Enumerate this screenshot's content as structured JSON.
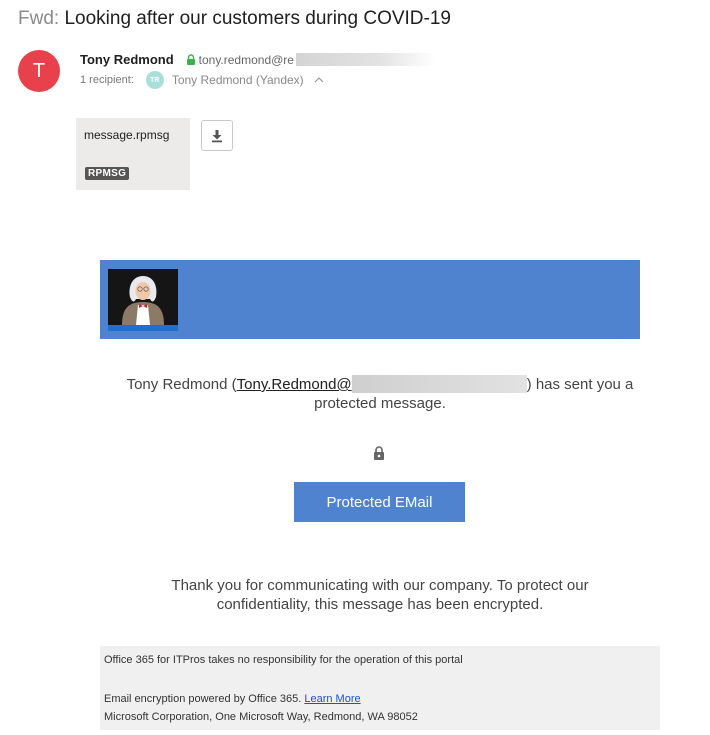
{
  "message": {
    "subject_prefix": "Fwd:",
    "subject": "Looking after our customers during COVID-19"
  },
  "sender": {
    "avatar_initial": "T",
    "avatar_color": "#e8414b",
    "name": "Tony Redmond",
    "email_partial": "tony.redmond@re",
    "recipients_label": "1 recipient:",
    "recipient_initials": "TR",
    "recipient_name": "Tony Redmond (Yandex)"
  },
  "attachment": {
    "filename": "message.rpmsg",
    "badge": "RPMSG",
    "download_icon": "download-icon"
  },
  "body": {
    "banner_color": "#4f83cf",
    "sent_name": "Tony Redmond (",
    "sent_email_partial": "Tony.Redmond@",
    "sent_suffix": ") has sent you a",
    "sent_line2": "protected message.",
    "button_label": "Protected EMail",
    "thanks_line1": "Thank you for communicating with our company. To protect our",
    "thanks_line2": "confidentiality, this message has been encrypted."
  },
  "footer": {
    "disclaimer": "Office 365 for ITPros takes no responsibility for the operation of this portal",
    "powered_by": "Email encryption powered by Office 365.",
    "learn_more": "Learn More",
    "address": "Microsoft Corporation, One Microsoft Way, Redmond, WA 98052"
  }
}
